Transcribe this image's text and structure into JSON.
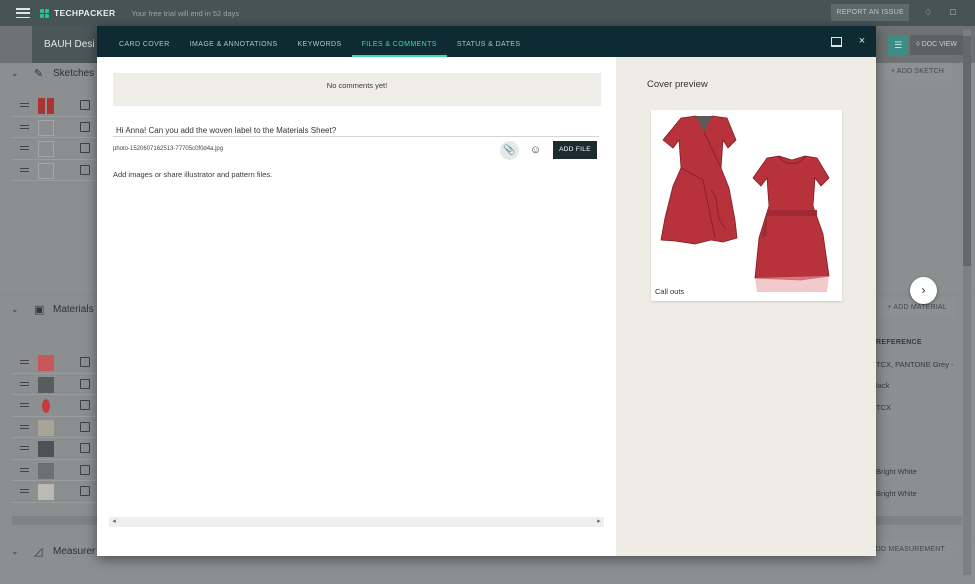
{
  "app": {
    "brand": "TECHPACKER",
    "trial_text": "Your free trial will end in 52 days",
    "report_button": "REPORT AN ISSUE",
    "doc_title": "BAUH Desi",
    "doc_view_button": "DOC VIEW"
  },
  "sections": {
    "sketches": {
      "label": "Sketches",
      "add_button": "ADD SKETCH"
    },
    "materials": {
      "label": "Materials",
      "add_button": "ADD MATERIAL",
      "reference_header": "REFERENCE",
      "references": [
        "TCX, PANTONE Grey -",
        "lack",
        "TCX",
        "",
        "",
        "Bright White",
        "Bright White"
      ]
    },
    "measurements": {
      "label": "Measurer",
      "add_button": "ADD MEASUREMENT"
    }
  },
  "modal": {
    "tabs": [
      {
        "label": "CARD COVER",
        "active": false
      },
      {
        "label": "IMAGE & ANNOTATIONS",
        "active": false
      },
      {
        "label": "KEYWORDS",
        "active": false
      },
      {
        "label": "FILES & COMMENTS",
        "active": true
      },
      {
        "label": "STATUS & DATES",
        "active": false
      }
    ],
    "no_comments": "No comments yet!",
    "comment_value": "Hi Anna! Can you add the woven label to the Materials Sheet?",
    "attached_file": "photo-1520607162513-77705c0f0d4a.jpg",
    "add_file_button": "ADD FILE",
    "helper_text": "Add images or share illustrator and pattern files.",
    "cover_preview_title": "Cover preview",
    "cover_caption": "Call outs"
  },
  "colors": {
    "modal_header": "#0e2a32",
    "active_tab": "#3fd7ae",
    "dress_red": "#b8323b",
    "topbar": "#465456"
  },
  "icons": {
    "menu": "hamburger-icon",
    "bell": "bell-icon",
    "chat": "chat-icon",
    "minimize": "minimize-icon",
    "close": "close-icon",
    "attach": "paperclip-icon",
    "emoji": "emoji-icon",
    "next": "chevron-right-icon"
  }
}
